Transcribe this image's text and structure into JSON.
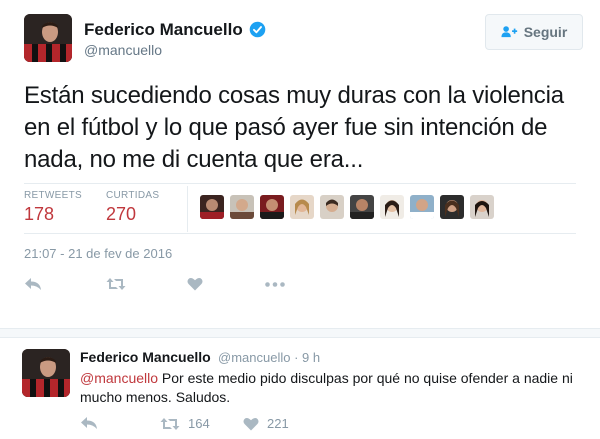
{
  "main_tweet": {
    "user_name": "Federico Mancuello",
    "user_handle": "@mancuello",
    "follow_label": "Seguir",
    "text": "Están sucediendo cosas muy duras con la violencia en el fútbol y lo que pasó ayer fue sin intención de nada, no me di cuenta que era...",
    "stats": {
      "retweets_label": "RETWEETS",
      "retweets_value": "178",
      "likes_label": "CURTIDAS",
      "likes_value": "270"
    },
    "timestamp": "21:07 - 21 de fev de 2016",
    "actions": [
      "reply-icon",
      "retweet-icon",
      "heart-icon",
      "more-icon"
    ]
  },
  "reply_tweet": {
    "user_name": "Federico Mancuello",
    "meta": "@mancuello · 9 h",
    "mention": "@mancuello",
    "text": " Por este medio pido disculpas por qué no quise ofender a nadie ni mucho menos. Saludos.",
    "retweet_count": "164",
    "like_count": "221"
  },
  "colors": {
    "accent": "#c0383d",
    "verified": "#1da1f2",
    "muted": "#8899a6",
    "border": "#e6ecf0"
  }
}
